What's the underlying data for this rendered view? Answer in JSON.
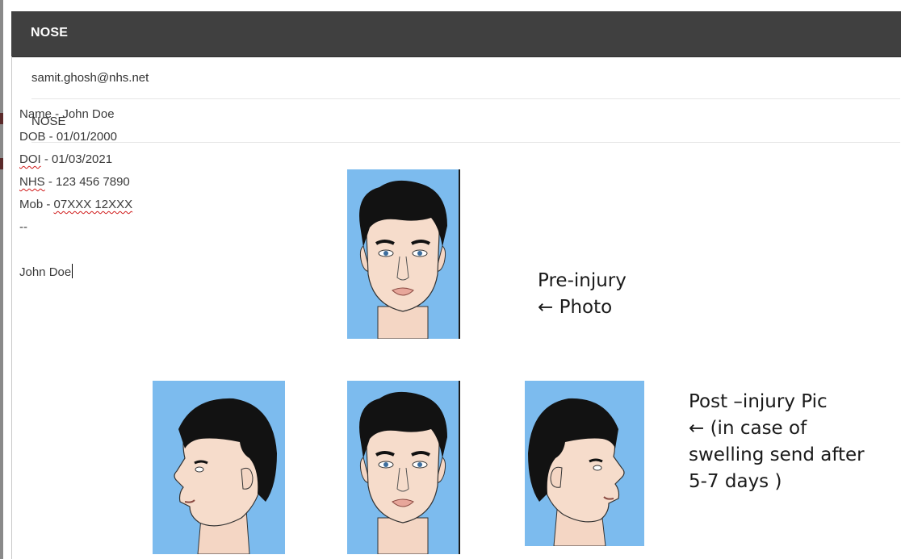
{
  "window": {
    "title": "NOSE"
  },
  "email": {
    "to": "samit.ghosh@nhs.net",
    "subject": "NOSE"
  },
  "body": {
    "name_line": "Name - John Doe",
    "dob_line": "DOB - 01/01/2000",
    "doi_label": "DOI",
    "doi_rest": " - 01/03/2021",
    "nhs_label": "NHS",
    "nhs_rest": " - 123 456 7890",
    "mob_prefix": "Mob - ",
    "mob_value": "07XXX 12XXX",
    "separator": "--",
    "signature": "John Doe"
  },
  "captions": {
    "pre_injury": {
      "line1": "Pre-injury",
      "line2": "← Photo"
    },
    "post_injury": {
      "line1": "Post –injury Pic",
      "line2": "← (in case of",
      "line3": "swelling send after",
      "line4": "5-7 days )"
    }
  },
  "colors": {
    "titlebar": "#404040",
    "photo_background": "#7cbbee",
    "spellcheck": "#d01a1a"
  }
}
